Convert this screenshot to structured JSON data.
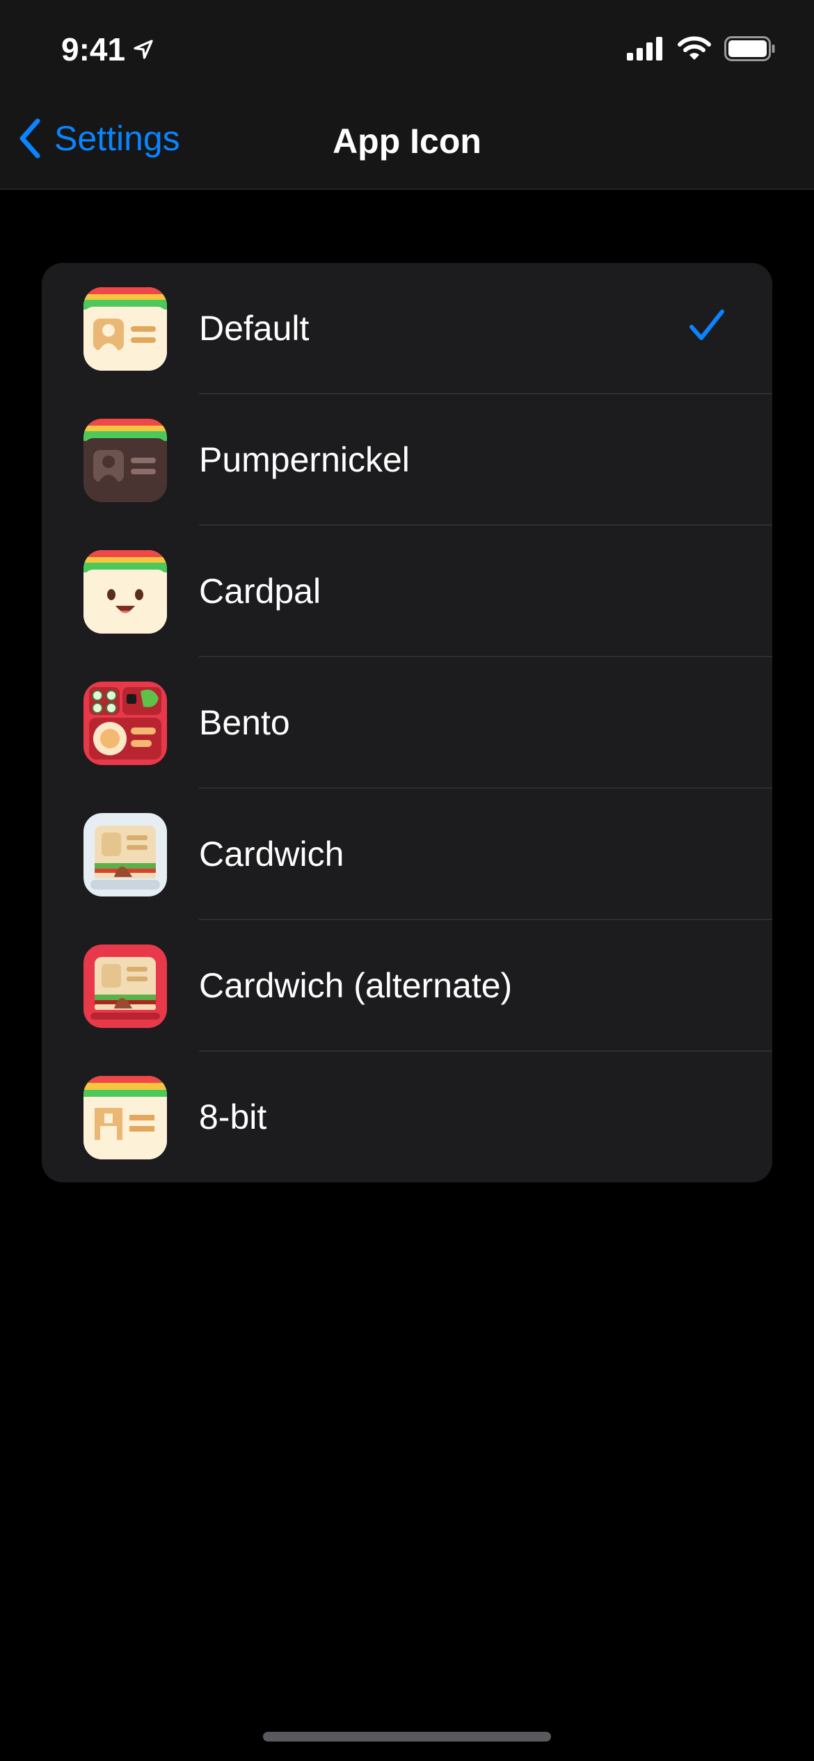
{
  "status": {
    "time": "9:41"
  },
  "nav": {
    "back_label": "Settings",
    "title": "App Icon"
  },
  "options": [
    {
      "label": "Default",
      "icon": "default-app-icon",
      "selected": true
    },
    {
      "label": "Pumpernickel",
      "icon": "pumpernickel-app-icon",
      "selected": false
    },
    {
      "label": "Cardpal",
      "icon": "cardpal-app-icon",
      "selected": false
    },
    {
      "label": "Bento",
      "icon": "bento-app-icon",
      "selected": false
    },
    {
      "label": "Cardwich",
      "icon": "cardwich-app-icon",
      "selected": false
    },
    {
      "label": "Cardwich (alternate)",
      "icon": "cardwich-alternate-app-icon",
      "selected": false
    },
    {
      "label": "8-bit",
      "icon": "8-bit-app-icon",
      "selected": false
    }
  ],
  "colors": {
    "accent": "#0a84ff",
    "background": "#000000",
    "card": "#1c1c1e",
    "navbar": "#161616"
  }
}
